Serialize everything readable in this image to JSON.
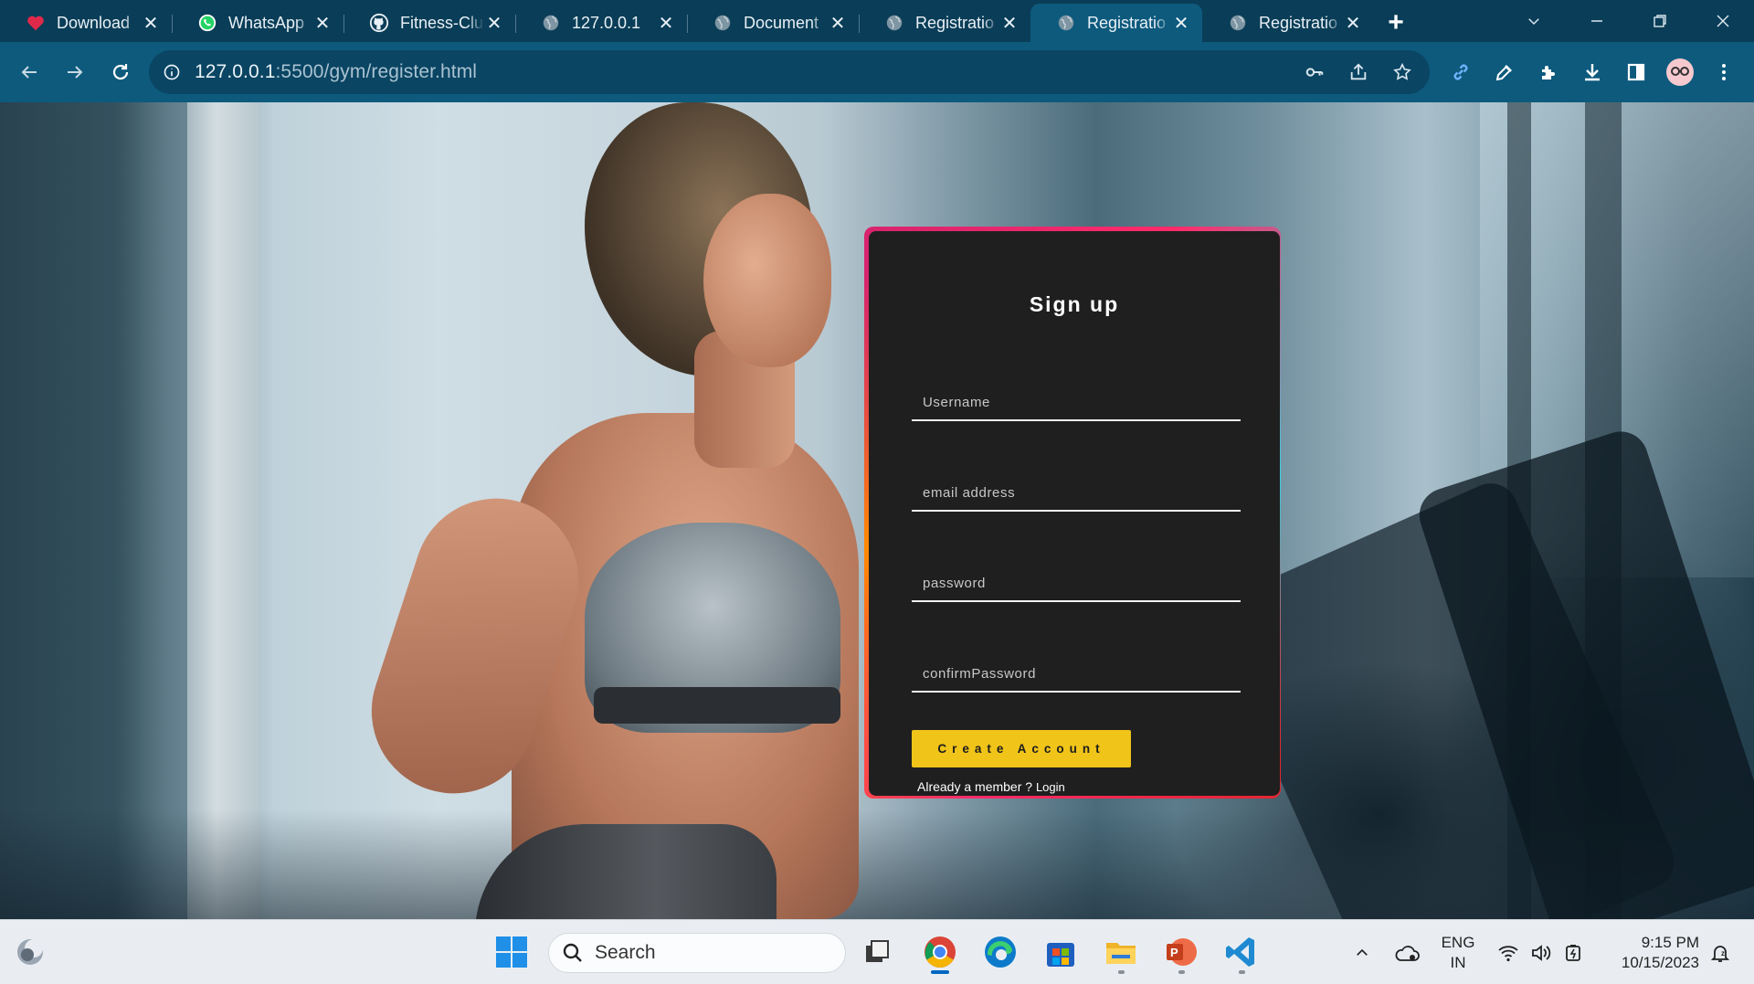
{
  "browser": {
    "tabs": [
      {
        "label": "Download",
        "icon": "heart-favicon",
        "active": false
      },
      {
        "label": "WhatsApp",
        "icon": "whatsapp-favicon",
        "active": false
      },
      {
        "label": "Fitness-Clu",
        "icon": "github-favicon",
        "active": false
      },
      {
        "label": "127.0.0.1",
        "icon": "globe-favicon",
        "active": false
      },
      {
        "label": "Document",
        "icon": "globe-favicon",
        "active": false
      },
      {
        "label": "Registratio",
        "icon": "globe-favicon",
        "active": false
      },
      {
        "label": "Registratio",
        "icon": "globe-favicon",
        "active": true
      },
      {
        "label": "Registratio",
        "icon": "globe-favicon",
        "active": false
      }
    ],
    "url_host": "127.0.0.1",
    "url_path": ":5500/gym/register.html",
    "accent": "#0d5a7d"
  },
  "signup": {
    "title": "Sign up",
    "username_placeholder": "Username",
    "email_placeholder": "email address",
    "password_placeholder": "password",
    "confirm_placeholder": "confirmPassword",
    "button_label": "Create Account",
    "already_text": "Already a member ? ",
    "login_label": "Login",
    "button_color": "#f0c419",
    "card_color": "#1f1f1f"
  },
  "taskbar": {
    "search_label": "Search",
    "lang_line1": "ENG",
    "lang_line2": "IN",
    "time": "9:15 PM",
    "date": "10/15/2023"
  }
}
